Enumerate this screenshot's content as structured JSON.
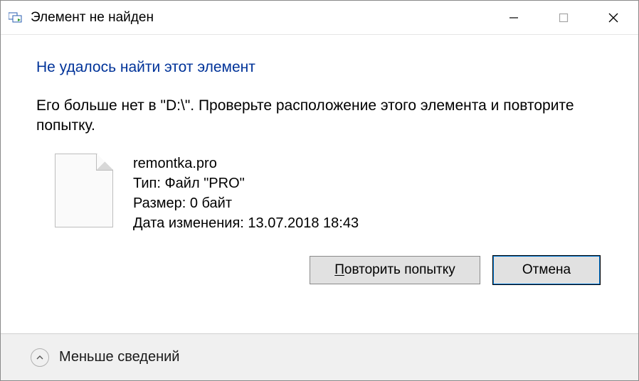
{
  "title": "Элемент не найден",
  "heading": "Не удалось найти этот элемент",
  "message": "Его больше нет в \"D:\\\". Проверьте расположение этого элемента и повторите попытку.",
  "file": {
    "name": "remontka.pro",
    "type_label": "Тип:",
    "type_value": "Файл \"PRO\"",
    "size_label": "Размер:",
    "size_value": "0 байт",
    "date_label": "Дата изменения:",
    "date_value": "13.07.2018 18:43"
  },
  "buttons": {
    "retry_prefix": "П",
    "retry_rest": "овторить попытку",
    "cancel": "Отмена"
  },
  "footer": {
    "less_details": "Меньше сведений"
  }
}
